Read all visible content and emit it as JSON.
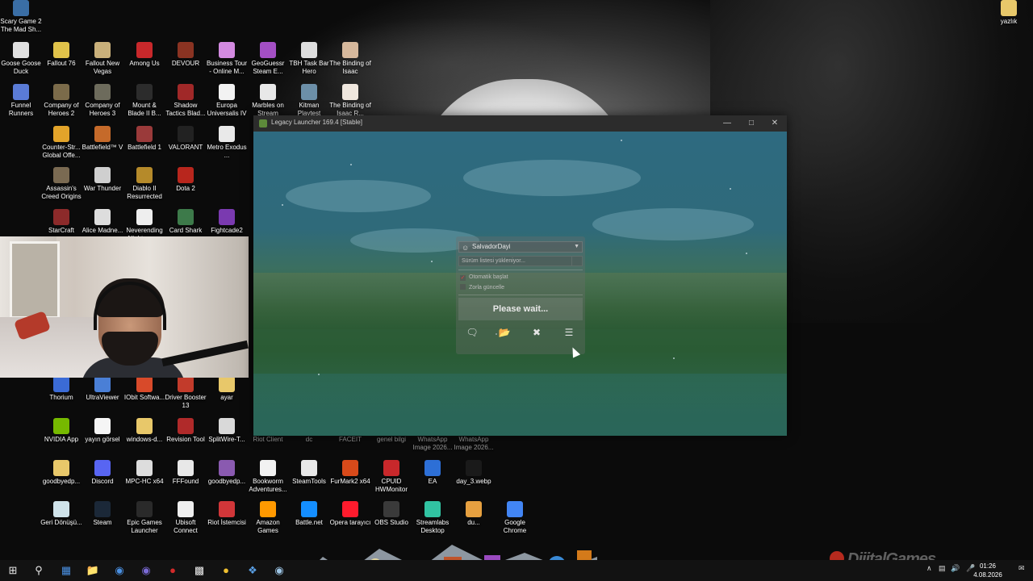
{
  "desktop": {
    "icons": [
      {
        "label": "Scary Game 2 The Mad Sh...",
        "color": "#3a6ea5"
      },
      {
        "label": "Goose Goose Duck",
        "color": "#e0e0e0"
      },
      {
        "label": "Fallout 76",
        "color": "#e0c24a"
      },
      {
        "label": "Fallout New Vegas",
        "color": "#c9b07a"
      },
      {
        "label": "Among Us",
        "color": "#c8282b"
      },
      {
        "label": "DEVOUR",
        "color": "#8a3322"
      },
      {
        "label": "Business Tour - Online M...",
        "color": "#d38ae0"
      },
      {
        "label": "GeoGuessr Steam E...",
        "color": "#a34fc4"
      },
      {
        "label": "TBH Task Bar Hero",
        "color": "#ddd"
      },
      {
        "label": "The Binding of Isaac",
        "color": "#d6b89c"
      },
      {
        "label": "Funnel Runners",
        "color": "#5a7bd6"
      },
      {
        "label": "Company of Heroes 2",
        "color": "#7b6b4a"
      },
      {
        "label": "Company of Heroes 3",
        "color": "#6d6b5c"
      },
      {
        "label": "Mount & Blade II B...",
        "color": "#2c2c2c"
      },
      {
        "label": "Shadow Tactics Blad...",
        "color": "#a02828"
      },
      {
        "label": "Europa Universalis IV",
        "color": "#f2f2f2"
      },
      {
        "label": "Marbles on Stream",
        "color": "#e8e8e8"
      },
      {
        "label": "Kitman Playtest",
        "color": "#6c8fa8"
      },
      {
        "label": "The Binding of Isaac R...",
        "color": "#efe7de"
      },
      {
        "label": "Counter-Str... Global Offe...",
        "color": "#e3a42a"
      },
      {
        "label": "Battlefield™ V",
        "color": "#c56a2a"
      },
      {
        "label": "Battlefield 1",
        "color": "#9a3a3a"
      },
      {
        "label": "VALORANT",
        "color": "#222"
      },
      {
        "label": "Metro Exodus ...",
        "color": "#e9e9e9"
      },
      {
        "label": "Assassin's Creed Origins",
        "color": "#7a6a52"
      },
      {
        "label": "War Thunder",
        "color": "#cfcfcf"
      },
      {
        "label": "Diablo II Resurrected",
        "color": "#b58a2a"
      },
      {
        "label": "Dota 2",
        "color": "#b8261d"
      },
      {
        "label": "StarCraft",
        "color": "#8c2a2a"
      },
      {
        "label": "Alice Madne...",
        "color": "#ddd"
      },
      {
        "label": "Neverending Nightmares",
        "color": "#eee"
      },
      {
        "label": "Card Shark",
        "color": "#3d7a4a"
      },
      {
        "label": "Fightcade2",
        "color": "#7a3ab0"
      },
      {
        "label": "Thorium",
        "color": "#3b6bd6"
      },
      {
        "label": "UltraViewer",
        "color": "#4a7fd6"
      },
      {
        "label": "IObit Softwa...",
        "color": "#d84a2a"
      },
      {
        "label": "Driver Booster 13",
        "color": "#c23b2b"
      },
      {
        "label": "ayar",
        "color": "#e8c86a"
      },
      {
        "label": "NVIDIA App",
        "color": "#76b900"
      },
      {
        "label": "yayın görsel",
        "color": "#f5f5f5"
      },
      {
        "label": "windows-d...",
        "color": "#e8c86a"
      },
      {
        "label": "Revision Tool",
        "color": "#b02a2a"
      },
      {
        "label": "SplitWire-T...",
        "color": "#d9d9d9"
      },
      {
        "label": "Riot Client",
        "color": "#c8282b"
      },
      {
        "label": "dc",
        "color": "#5865f2"
      },
      {
        "label": "FACEIT",
        "color": "#ff5500"
      },
      {
        "label": "genel bilgi",
        "color": "#eee"
      },
      {
        "label": "WhatsApp Image 2026...",
        "color": "#25d366"
      },
      {
        "label": "WhatsApp Image 2026...",
        "color": "#25d366"
      },
      {
        "label": "goodbyedp...",
        "color": "#e8c86a"
      },
      {
        "label": "Discord",
        "color": "#5865f2"
      },
      {
        "label": "MPC-HC x64",
        "color": "#ddd"
      },
      {
        "label": "FFFound",
        "color": "#e8e8e8"
      },
      {
        "label": "goodbyedp...",
        "color": "#8a5ab0"
      },
      {
        "label": "Bookworm Adventures...",
        "color": "#f2f2f2"
      },
      {
        "label": "SteamTools",
        "color": "#e8e8e8"
      },
      {
        "label": "FurMark2 x64",
        "color": "#d84a1a"
      },
      {
        "label": "CPUID HWMonitor",
        "color": "#c8282b"
      },
      {
        "label": "EA",
        "color": "#2d6fd6"
      },
      {
        "label": "day_3.webp",
        "color": "#1a1a1a"
      },
      {
        "label": "Geri Dönüşü...",
        "color": "#cfe3ea"
      },
      {
        "label": "Steam",
        "color": "#1b2838"
      },
      {
        "label": "Epic Games Launcher",
        "color": "#2a2a2a"
      },
      {
        "label": "Ubisoft Connect",
        "color": "#eee"
      },
      {
        "label": "Riot İstemcisi",
        "color": "#d13639"
      },
      {
        "label": "Amazon Games",
        "color": "#ff9900"
      },
      {
        "label": "Battle.net",
        "color": "#148eff"
      },
      {
        "label": "Opera tarayıcı",
        "color": "#ff1b2d"
      },
      {
        "label": "OBS Studio",
        "color": "#3a3a3a"
      },
      {
        "label": "Streamlabs Desktop",
        "color": "#31c3a2"
      },
      {
        "label": "du...",
        "color": "#e6a040"
      },
      {
        "label": "Google Chrome",
        "color": "#4285f4"
      },
      {
        "label": "yazlık",
        "color": "#e8c86a"
      }
    ]
  },
  "launcher": {
    "title": "Legacy Launcher 169.4 [Stable]",
    "account": "SalvadorDayi",
    "version_placeholder": "Sürüm listesi yükleniyor...",
    "auto_start": "Otomatik başlat",
    "force_update": "Zorla güncelle",
    "status": "Please wait...",
    "buttons": [
      "chat",
      "folder",
      "tools",
      "menu"
    ]
  },
  "taskbar": {
    "time": "01:26",
    "date": "4.08.2026",
    "start_icon": "windows-icon",
    "search_icon": "search-icon"
  },
  "watermark": "DijitalGames"
}
